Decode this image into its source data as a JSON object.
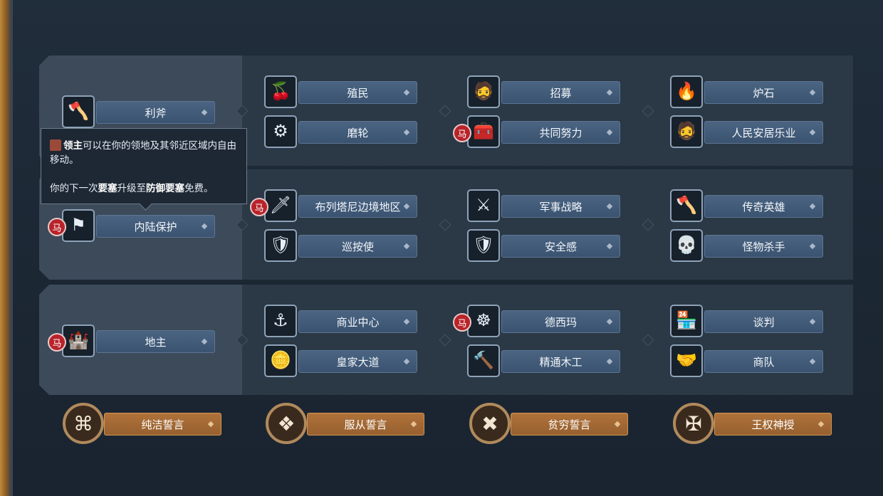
{
  "tree": {
    "rows": [
      {
        "first": {
          "label": "利斧",
          "icon": "axe-icon",
          "glyph": "🪓",
          "badge": false
        },
        "groups": [
          [
            {
              "label": "殖民",
              "icon": "fruit-basket-icon",
              "glyph": "🍒",
              "badge": false
            },
            {
              "label": "磨轮",
              "icon": "grindstone-icon",
              "glyph": "⚙",
              "badge": false
            }
          ],
          [
            {
              "label": "招募",
              "icon": "recruit-man-icon",
              "glyph": "🧔",
              "badge": false
            },
            {
              "label": "共同努力",
              "icon": "chest-icon",
              "glyph": "🧰",
              "badge": true
            }
          ],
          [
            {
              "label": "炉石",
              "icon": "fire-icon",
              "glyph": "🔥",
              "badge": false
            },
            {
              "label": "人民安居乐业",
              "icon": "happy-man-icon",
              "glyph": "🧔",
              "badge": false
            }
          ]
        ]
      },
      {
        "first": {
          "label": "内陆保护",
          "icon": "banner-icon",
          "glyph": "⚑",
          "badge": true
        },
        "groups": [
          [
            {
              "label": "布列塔尼边境地区",
              "icon": "spear-icon",
              "glyph": "🗡",
              "badge": true
            },
            {
              "label": "巡按使",
              "icon": "red-shield-icon",
              "glyph": "🛡",
              "badge": false
            }
          ],
          [
            {
              "label": "军事战略",
              "icon": "sword-icon",
              "glyph": "⚔",
              "badge": false
            },
            {
              "label": "安全感",
              "icon": "shield-icon",
              "glyph": "🛡",
              "badge": false
            }
          ],
          [
            {
              "label": "传奇英雄",
              "icon": "battle-axe-icon",
              "glyph": "🪓",
              "badge": false
            },
            {
              "label": "怪物杀手",
              "icon": "skull-icon",
              "glyph": "💀",
              "badge": false
            }
          ]
        ]
      },
      {
        "first": {
          "label": "地主",
          "icon": "estate-icon",
          "glyph": "🏰",
          "badge": true
        },
        "groups": [
          [
            {
              "label": "商业中心",
              "icon": "anchor-icon",
              "glyph": "⚓",
              "badge": false
            },
            {
              "label": "皇家大道",
              "icon": "coin-stack-icon",
              "glyph": "🪙",
              "badge": false
            }
          ],
          [
            {
              "label": "德西玛",
              "icon": "gold-wheel-icon",
              "glyph": "☸",
              "badge": true
            },
            {
              "label": "精通木工",
              "icon": "hammer-icon",
              "glyph": "🔨",
              "badge": false
            }
          ],
          [
            {
              "label": "谈判",
              "icon": "market-icon",
              "glyph": "🏪",
              "badge": false
            },
            {
              "label": "商队",
              "icon": "trade-icon",
              "glyph": "🤝",
              "badge": false
            }
          ]
        ]
      }
    ]
  },
  "oaths": [
    {
      "label": "纯洁誓言",
      "icon": "knot-purity-icon",
      "glyph": "⌘"
    },
    {
      "label": "服从誓言",
      "icon": "knot-obedience-icon",
      "glyph": "❖"
    },
    {
      "label": "贫穷誓言",
      "icon": "knot-poverty-icon",
      "glyph": "✖"
    },
    {
      "label": "王权神授",
      "icon": "cross-divine-icon",
      "glyph": "✠"
    }
  ],
  "tooltip": {
    "governor": "领主",
    "line1_rest": "可以在你的领地及其邻近区域内自由移动。",
    "line2_a": "你的下一次",
    "fortress": "要塞",
    "line2_b": "升级至",
    "defensive_fortress": "防御要塞",
    "line2_c": "免费。"
  },
  "badge_glyph": "马",
  "colors": {
    "accent_bar": "#3f5a78",
    "oath_bar": "#a86a35",
    "badge_red": "#b8232a"
  }
}
